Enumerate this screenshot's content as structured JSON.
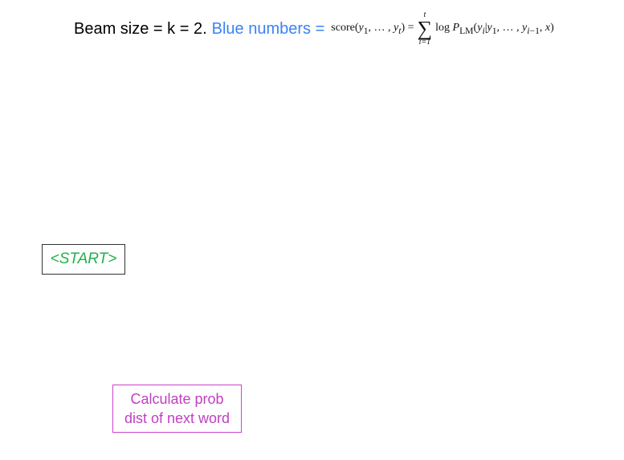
{
  "header": {
    "beam_text": "Beam size = k = 2.",
    "blue_label": "Blue numbers =",
    "formula": {
      "lhs": "score(y",
      "sum_upper": "t",
      "sum_lower": "i=1",
      "rhs": "log P"
    }
  },
  "diagram": {
    "start_node": "<START>",
    "action_box": {
      "line1": "Calculate prob",
      "line2": "dist of next word"
    }
  },
  "colors": {
    "blue": "#3b82f6",
    "green": "#22b14c",
    "magenta": "#c040c0"
  }
}
